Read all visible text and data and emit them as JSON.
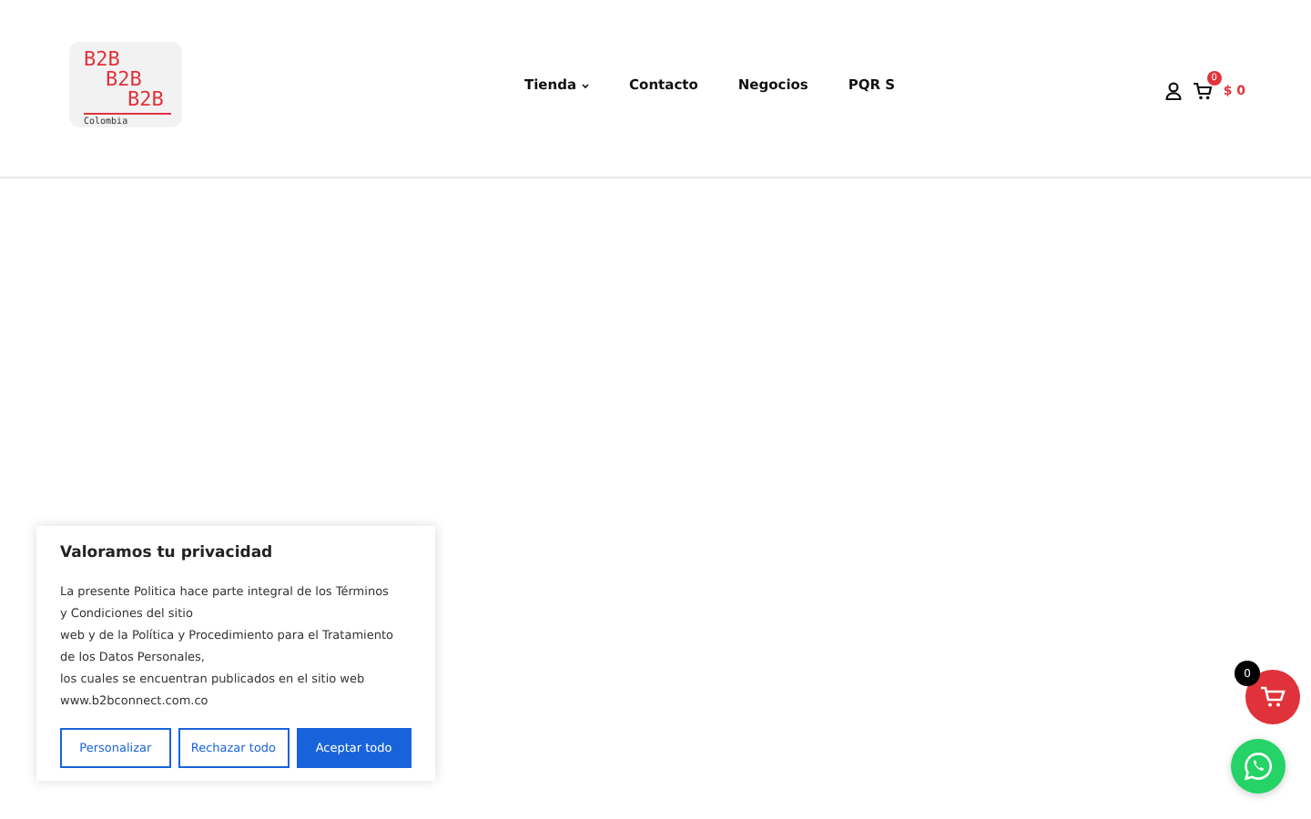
{
  "logo": {
    "lines": [
      "B2B",
      "B2B",
      "B2B"
    ],
    "caption": "Colombia"
  },
  "nav": [
    {
      "label": "Tienda",
      "dropdown": true
    },
    {
      "label": "Contacto",
      "dropdown": false
    },
    {
      "label": "Negocios",
      "dropdown": false
    },
    {
      "label": "PQR S",
      "dropdown": false
    }
  ],
  "cart": {
    "count": "0",
    "total": "$ 0"
  },
  "cookie_banner": {
    "title": "Valoramos tu privacidad",
    "text_lines": [
      "La presente Politica hace parte integral de los Términos",
      "y Condiciones del sitio",
      "web y de la Política y Procedimiento para el Tratamiento",
      "de los Datos Personales,",
      "los cuales se encuentran publicados en el sitio web",
      "www.b2bconnect.com.co"
    ],
    "buttons": [
      {
        "label": "Personalizar",
        "kind": "outline"
      },
      {
        "label": "Rechazar todo",
        "kind": "outline"
      },
      {
        "label": "Aceptar todo",
        "kind": "primary"
      }
    ]
  },
  "floating_cart": {
    "count": "0"
  }
}
